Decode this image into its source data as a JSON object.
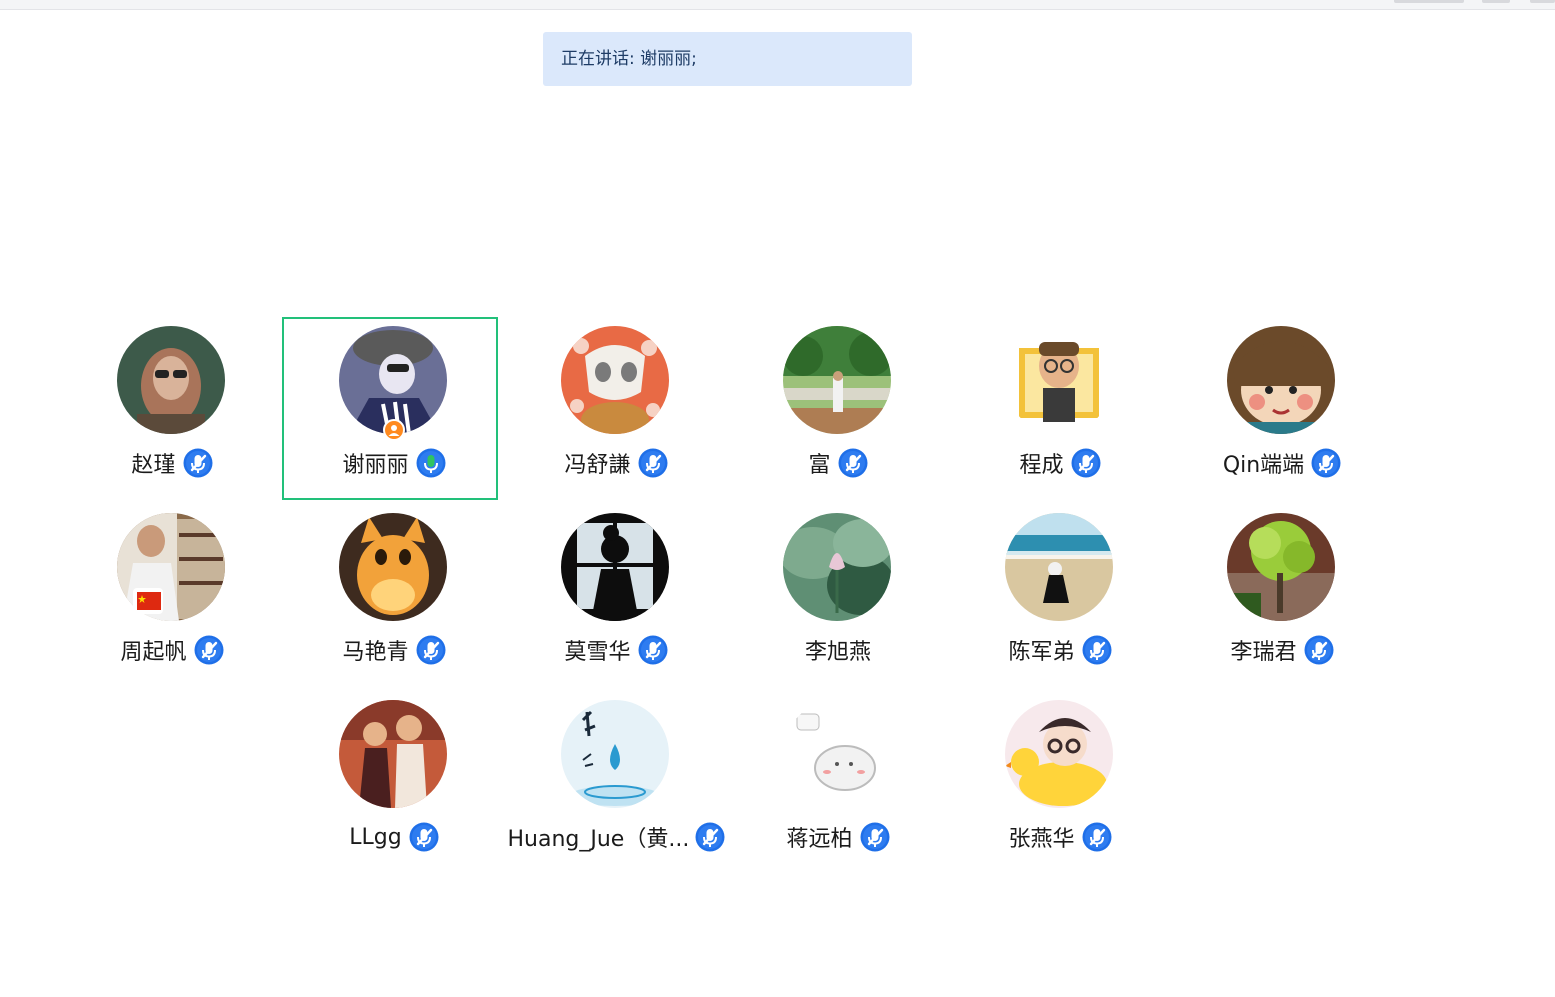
{
  "speaking": {
    "text": "正在讲话: 谢丽丽;"
  },
  "participants": [
    {
      "name": "赵瑾",
      "mic": "muted",
      "avatar": "woman-sunglasses",
      "colors": [
        "#3d5a4a",
        "#a9745a",
        "#d9b39a"
      ]
    },
    {
      "name": "谢丽丽",
      "mic": "speaking",
      "avatar": "woman-cap",
      "colors": [
        "#6a6f96",
        "#2a2f5e",
        "#e8e6f2"
      ],
      "host": true,
      "selected": true
    },
    {
      "name": "冯舒謙",
      "mic": "muted",
      "avatar": "dog-mask",
      "colors": [
        "#e86a45",
        "#f2efe9",
        "#c98a3e"
      ]
    },
    {
      "name": "富",
      "mic": "muted",
      "avatar": "park-man",
      "colors": [
        "#3f7f3a",
        "#9cc17a",
        "#d9d7c9"
      ]
    },
    {
      "name": "程成",
      "mic": "muted",
      "avatar": "cartoon-man",
      "colors": [
        "#ffffff",
        "#f3c23a",
        "#6a4a2a"
      ]
    },
    {
      "name": "Qin端端",
      "mic": "muted",
      "avatar": "cartoon-girl",
      "colors": [
        "#6b4a2a",
        "#f3d6b9",
        "#e84a4a"
      ]
    },
    {
      "name": "周起帆",
      "mic": "muted",
      "avatar": "bookshelf-man",
      "colors": [
        "#8a6a4a",
        "#e8e1d6",
        "#c7b49a"
      ],
      "flag": true
    },
    {
      "name": "马艳青",
      "mic": "muted",
      "avatar": "orange-kitten",
      "colors": [
        "#3e2b1f",
        "#f2a23a",
        "#ffd37a"
      ]
    },
    {
      "name": "莫雪华",
      "mic": "muted",
      "avatar": "silhouette-window",
      "colors": [
        "#0d0d0d",
        "#d7e2e8",
        "#3a3a3a"
      ]
    },
    {
      "name": "李旭燕",
      "mic": "none",
      "avatar": "lotus",
      "colors": [
        "#5f8f74",
        "#e8c7d6",
        "#2f5a42"
      ]
    },
    {
      "name": "陈军弟",
      "mic": "muted",
      "avatar": "beach",
      "colors": [
        "#2d8fb0",
        "#d9c7a0",
        "#111111"
      ]
    },
    {
      "name": "李瑞君",
      "mic": "muted",
      "avatar": "tree",
      "colors": [
        "#6a3a2a",
        "#9acc3a",
        "#2f5a1f"
      ]
    },
    {
      "name": "LLgg",
      "mic": "muted",
      "avatar": "two-kids",
      "colors": [
        "#c45a3a",
        "#f2e7dc",
        "#4a1f1f"
      ]
    },
    {
      "name": "Huang_Jue（黄...",
      "mic": "muted",
      "avatar": "water-drop",
      "colors": [
        "#e6f2f8",
        "#2a9ad0",
        "#1a2a3a"
      ]
    },
    {
      "name": "蒋远柏",
      "mic": "muted",
      "avatar": "cartoon-cat",
      "colors": [
        "#ffffff",
        "#f2f2f2",
        "#bcbcbc"
      ]
    },
    {
      "name": "张燕华",
      "mic": "muted",
      "avatar": "duck-girl",
      "colors": [
        "#f7e9ec",
        "#ffd43a",
        "#3a2a2a"
      ]
    }
  ],
  "colors": {
    "mic": "#1f6fe8",
    "mic_active": "#2fc462",
    "selection": "#22c07a",
    "speaking_bg": "#dbe8fb"
  }
}
